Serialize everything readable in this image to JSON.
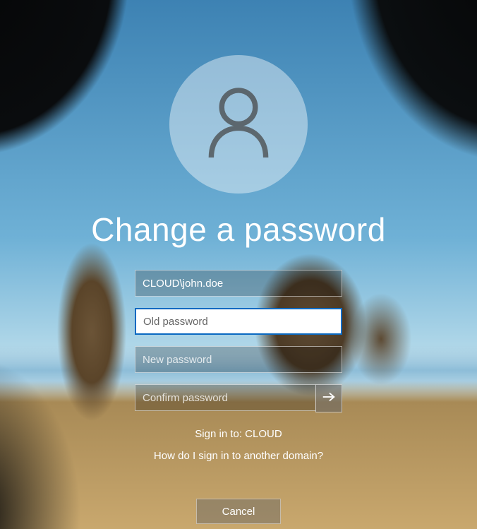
{
  "title": "Change a password",
  "username": {
    "value": "CLOUD\\john.doe"
  },
  "old_password": {
    "placeholder": "Old password",
    "value": ""
  },
  "new_password": {
    "placeholder": "New password",
    "value": ""
  },
  "confirm_password": {
    "placeholder": "Confirm password",
    "value": ""
  },
  "sign_in_to": "Sign in to: CLOUD",
  "other_domain_link": "How do I sign in to another domain?",
  "cancel_label": "Cancel",
  "icons": {
    "avatar": "user-icon",
    "submit": "arrow-right-icon"
  }
}
